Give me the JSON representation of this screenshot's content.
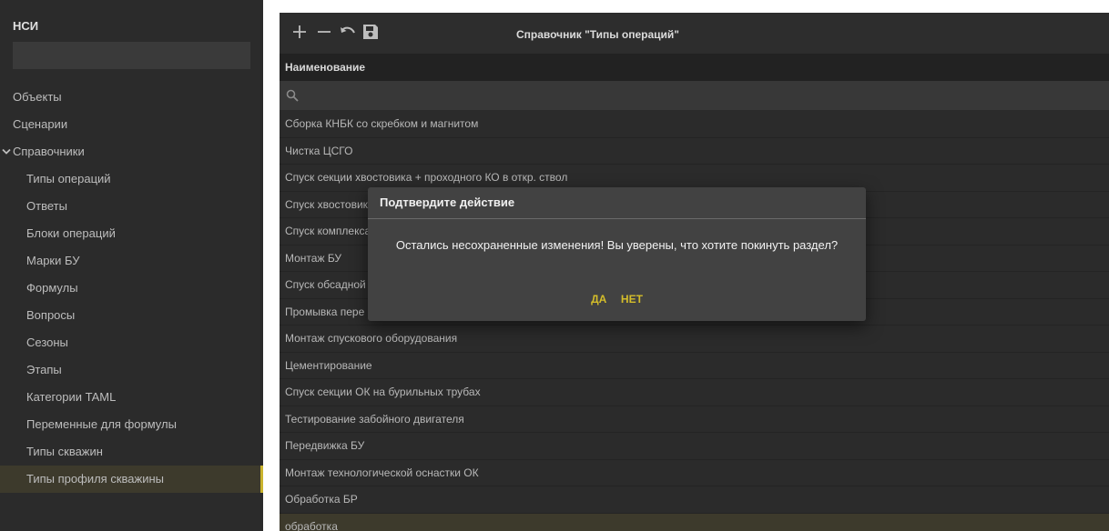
{
  "sidebar": {
    "header": "НСИ",
    "search_value": "",
    "items": [
      {
        "label": "Объекты",
        "level": 0
      },
      {
        "label": "Сценарии",
        "level": 0
      },
      {
        "label": "Справочники",
        "level": 0,
        "expanded": true
      },
      {
        "label": "Типы операций",
        "level": 1
      },
      {
        "label": "Ответы",
        "level": 1
      },
      {
        "label": "Блоки операций",
        "level": 1
      },
      {
        "label": "Марки БУ",
        "level": 1
      },
      {
        "label": "Формулы",
        "level": 1
      },
      {
        "label": "Вопросы",
        "level": 1
      },
      {
        "label": "Сезоны",
        "level": 1
      },
      {
        "label": "Этапы",
        "level": 1
      },
      {
        "label": "Категории TAML",
        "level": 1
      },
      {
        "label": "Переменные для формулы",
        "level": 1
      },
      {
        "label": "Типы скважин",
        "level": 1
      },
      {
        "label": "Типы профиля скважины",
        "level": 1,
        "active": true
      }
    ]
  },
  "main": {
    "title": "Справочник \"Типы операций\"",
    "toolbar": {
      "icons": [
        "plus-icon",
        "minus-icon",
        "undo-icon",
        "save-icon"
      ]
    },
    "column_header": "Наименование",
    "filter_value": "",
    "rows": [
      "Сборка КНБК со скребком и магнитом",
      "Чистка ЦСГО",
      "Спуск секции хвостовика + проходного КО в откр. ствол",
      "Спуск хвостовика",
      "Спуск комплекса",
      "Монтаж БУ",
      "Спуск обсадной",
      "Промывка пере",
      "Монтаж спускового оборудования",
      "Цементирование",
      "Спуск секции ОК на бурильных трубах",
      "Тестирование забойного двигателя",
      "Передвижка БУ",
      "Монтаж технологической оснастки ОК",
      "Обработка БР",
      "обработка"
    ]
  },
  "dialog": {
    "title": "Подтвердите действие",
    "message": "Остались несохраненные изменения! Вы уверены, что хотите покинуть раздел?",
    "yes_label": "ДА",
    "no_label": "НЕТ"
  },
  "colors": {
    "accent": "#d4bd2a",
    "background": "#2b2b2b",
    "active_row": "#3d3a2c"
  }
}
